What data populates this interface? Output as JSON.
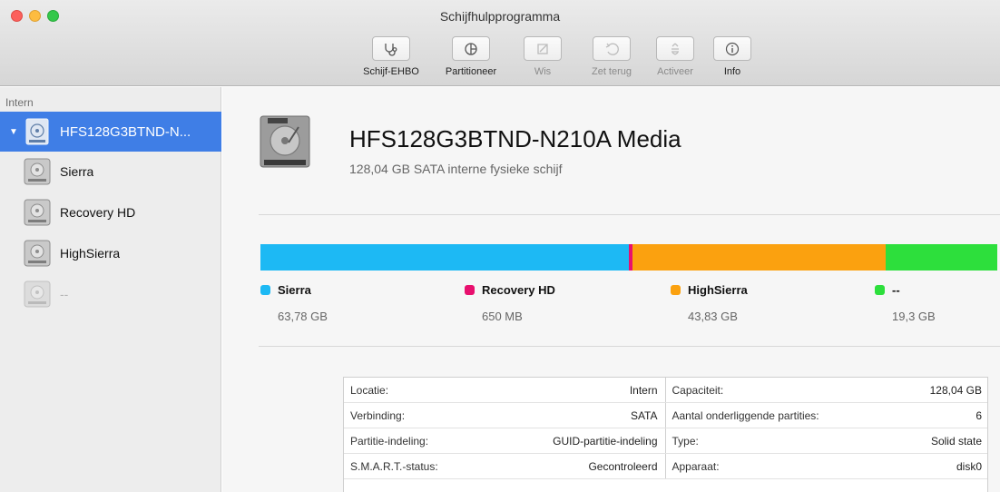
{
  "window": {
    "title": "Schijfhulpprogramma"
  },
  "toolbar": {
    "buttons": [
      {
        "label": "Schijf-EHBO",
        "icon": "stethoscope-icon",
        "enabled": true
      },
      {
        "label": "Partitioneer",
        "icon": "pie-partition-icon",
        "enabled": true
      },
      {
        "label": "Wis",
        "icon": "erase-icon",
        "enabled": false
      },
      {
        "label": "Zet terug",
        "icon": "restore-icon",
        "enabled": false
      },
      {
        "label": "Activeer",
        "icon": "mount-icon",
        "enabled": false
      },
      {
        "label": "Info",
        "icon": "info-icon",
        "enabled": true
      }
    ]
  },
  "sidebar": {
    "header": "Intern",
    "items": [
      {
        "label": "HFS128G3BTND-N...",
        "level": 0,
        "selected": true
      },
      {
        "label": "Sierra",
        "level": 1
      },
      {
        "label": "Recovery HD",
        "level": 1
      },
      {
        "label": "HighSierra",
        "level": 1
      },
      {
        "label": "--",
        "level": 1,
        "dimmed": true
      }
    ]
  },
  "disk": {
    "name": "HFS128G3BTND-N210A Media",
    "subtitle": "128,04 GB SATA interne fysieke schijf"
  },
  "partitions": [
    {
      "name": "Sierra",
      "size": "63,78 GB",
      "color": "#1db9f4",
      "fraction": 0.4981
    },
    {
      "name": "Recovery HD",
      "size": "650 MB",
      "color": "#e8106e",
      "fraction": 0.0051
    },
    {
      "name": "HighSierra",
      "size": "43,83 GB",
      "color": "#fba10f",
      "fraction": 0.3423
    },
    {
      "name": "--",
      "size": "19,3 GB",
      "color": "#2ddf3c",
      "fraction": 0.1507
    }
  ],
  "info": {
    "rows": [
      {
        "lk": "Locatie:",
        "lv": "Intern",
        "rk": "Capaciteit:",
        "rv": "128,04 GB"
      },
      {
        "lk": "Verbinding:",
        "lv": "SATA",
        "rk": "Aantal onderliggende partities:",
        "rv": "6"
      },
      {
        "lk": "Partitie-indeling:",
        "lv": "GUID-partitie-indeling",
        "rk": "Type:",
        "rv": "Solid state"
      },
      {
        "lk": "S.M.A.R.T.-status:",
        "lv": "Gecontroleerd",
        "rk": "Apparaat:",
        "rv": "disk0"
      }
    ]
  }
}
